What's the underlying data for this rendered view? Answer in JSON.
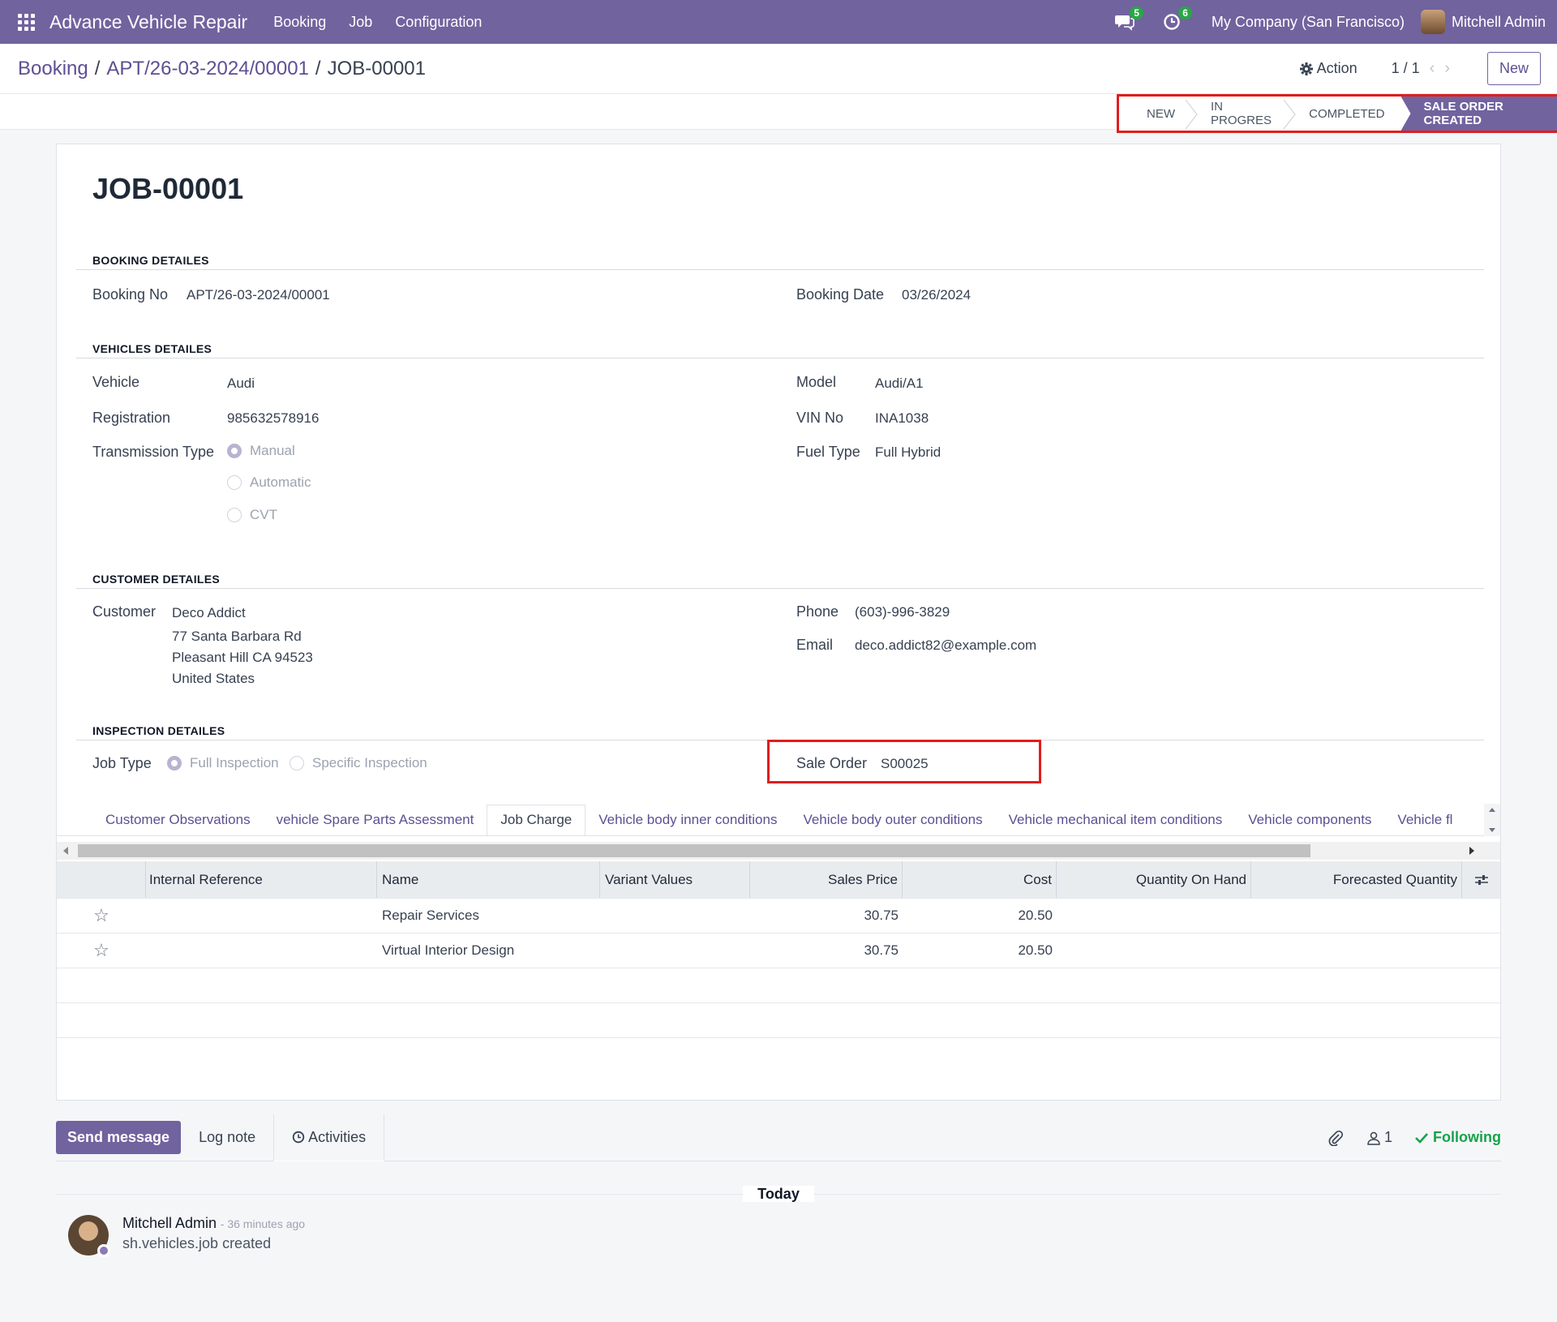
{
  "navbar": {
    "app_name": "Advance Vehicle Repair",
    "menu": [
      "Booking",
      "Job",
      "Configuration"
    ],
    "messages_count": "5",
    "activities_count": "6",
    "company": "My Company (San Francisco)",
    "user": "Mitchell Admin",
    "accent_color": "#71639e"
  },
  "control": {
    "breadcrumb": [
      "Booking",
      "APT/26-03-2024/00001",
      "JOB-00001"
    ],
    "action_label": "Action",
    "pager": "1 / 1",
    "new_label": "New"
  },
  "status": {
    "stages": [
      "NEW",
      "IN PROGRES",
      "COMPLETED",
      "SALE ORDER CREATED"
    ],
    "active": "SALE ORDER CREATED"
  },
  "form": {
    "title": "JOB-00001",
    "booking": {
      "heading": "BOOKING DETAILES",
      "no_label": "Booking No",
      "no_value": "APT/26-03-2024/00001",
      "date_label": "Booking Date",
      "date_value": "03/26/2024"
    },
    "vehicle": {
      "heading": "VEHICLES DETAILES",
      "vehicle_label": "Vehicle",
      "vehicle_value": "Audi",
      "registration_label": "Registration",
      "registration_value": "985632578916",
      "transmission_label": "Transmission Type",
      "transmission_options": [
        "Manual",
        "Automatic",
        "CVT"
      ],
      "transmission_selected": "Manual",
      "model_label": "Model",
      "model_value": "Audi/A1",
      "vin_label": "VIN No",
      "vin_value": "INA1038",
      "fuel_label": "Fuel Type",
      "fuel_value": "Full Hybrid"
    },
    "customer": {
      "heading": "CUSTOMER DETAILES",
      "customer_label": "Customer",
      "customer_name": "Deco Addict",
      "address_line1": "77 Santa Barbara Rd",
      "address_line2": "Pleasant Hill CA 94523",
      "address_line3": "United States",
      "phone_label": "Phone",
      "phone_value": "(603)-996-3829",
      "email_label": "Email",
      "email_value": "deco.addict82@example.com"
    },
    "inspection": {
      "heading": "INSPECTION DETAILES",
      "job_type_label": "Job Type",
      "job_type_options": [
        "Full Inspection",
        "Specific Inspection"
      ],
      "job_type_selected": "Full Inspection",
      "sale_order_label": "Sale Order",
      "sale_order_value": "S00025"
    }
  },
  "tabs": [
    "Customer Observations",
    "vehicle Spare Parts Assessment",
    "Job Charge",
    "Vehicle body inner conditions",
    "Vehicle body outer conditions",
    "Vehicle mechanical item conditions",
    "Vehicle components",
    "Vehicle fl"
  ],
  "active_tab": "Job Charge",
  "table": {
    "headers": [
      "Internal Reference",
      "Name",
      "Variant Values",
      "Sales Price",
      "Cost",
      "Quantity On Hand",
      "Forecasted Quantity"
    ],
    "rows": [
      {
        "ref": "",
        "name": "Repair Services",
        "variant": "",
        "price": "30.75",
        "cost": "20.50",
        "qoh": "",
        "forecast": ""
      },
      {
        "ref": "",
        "name": "Virtual Interior Design",
        "variant": "",
        "price": "30.75",
        "cost": "20.50",
        "qoh": "",
        "forecast": ""
      }
    ]
  },
  "chatter": {
    "send_message": "Send message",
    "log_note": "Log note",
    "activities": "Activities",
    "followers_count": "1",
    "following": "Following",
    "date_separator": "Today",
    "message": {
      "author": "Mitchell Admin",
      "time": "- 36 minutes ago",
      "body": "sh.vehicles.job created"
    }
  }
}
